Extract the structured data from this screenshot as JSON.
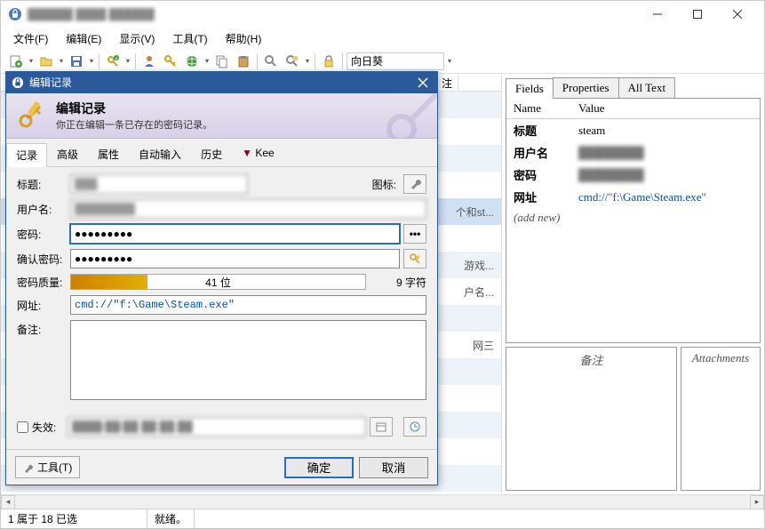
{
  "window": {
    "title": "██████ ████ ██████"
  },
  "menu": {
    "file": "文件(F)",
    "edit": "编辑(E)",
    "view": "显示(V)",
    "tools": "工具(T)",
    "help": "帮助(H)"
  },
  "toolbar": {
    "search_placeholder": "向日葵"
  },
  "bg_list": {
    "col_notes": "注",
    "rows": [
      {
        "text": ""
      },
      {
        "text": ""
      },
      {
        "text": "个和st..."
      },
      {
        "text": ""
      },
      {
        "text": "游戏..."
      },
      {
        "text": "户名..."
      },
      {
        "text": ""
      },
      {
        "text": "网三"
      },
      {
        "text": ""
      },
      {
        "text": ""
      },
      {
        "text": ""
      },
      {
        "text": ""
      },
      {
        "text": ""
      },
      {
        "text": ""
      }
    ]
  },
  "right_panel": {
    "tabs": {
      "fields": "Fields",
      "properties": "Properties",
      "alltext": "All Text"
    },
    "name_header": "Name",
    "value_header": "Value",
    "rows": {
      "title_label": "标题",
      "title_value": "steam",
      "user_label": "用户名",
      "user_value": "████████",
      "pass_label": "密码",
      "pass_value": "████████",
      "url_label": "网址",
      "url_value": "cmd://\"f:\\Game\\Steam.exe\"",
      "addnew": "(add new)"
    },
    "notes_label": "备注",
    "attach_label": "Attachments"
  },
  "dialog": {
    "title": "编辑记录",
    "header_title": "编辑记录",
    "header_sub": "你正在编辑一条已存在的密码记录。",
    "tabs": {
      "record": "记录",
      "advanced": "高级",
      "properties": "属性",
      "autotype": "自动输入",
      "history": "历史",
      "kee": "Kee"
    },
    "labels": {
      "title": "标题:",
      "icon": "图标:",
      "user": "用户名:",
      "pass": "密码:",
      "confirm": "确认密码:",
      "quality": "密码质量:",
      "url": "网址:",
      "notes": "备注:",
      "expire": "失效:"
    },
    "values": {
      "title": "███",
      "user": "████████",
      "pass": "●●●●●●●●●",
      "confirm": "●●●●●●●●●",
      "quality_bits": "41 位",
      "quality_chars": "9 字符",
      "url": "cmd://\"f:\\Game\\Steam.exe\"",
      "expire_date": "████/██/██ ██:██:██"
    },
    "footer": {
      "tools": "工具(T)",
      "ok": "确定",
      "cancel": "取消"
    }
  },
  "status": {
    "selection": "1 属于 18 已选",
    "ready": "就绪。"
  }
}
